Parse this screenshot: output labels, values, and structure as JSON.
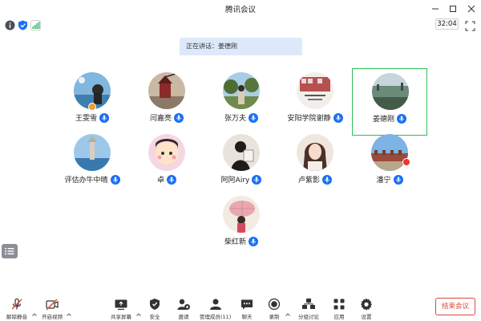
{
  "window": {
    "title": "腾讯会议"
  },
  "status": {
    "timer": "32:04"
  },
  "speaking": {
    "text": "正在讲话：姜德刚"
  },
  "participants": [
    {
      "name": "王雯雪",
      "mic": "on",
      "host": true
    },
    {
      "name": "闫嘉亮",
      "mic": "on"
    },
    {
      "name": "张万夫",
      "mic": "on"
    },
    {
      "name": "安阳学院谢静",
      "mic": "on"
    },
    {
      "name": "姜德刚",
      "mic": "on",
      "speaking": true
    },
    {
      "name": "评估办牛中晴",
      "mic": "on"
    },
    {
      "name": "卓",
      "mic": "on"
    },
    {
      "name": "阿阿Airy",
      "mic": "on"
    },
    {
      "name": "卢紫影",
      "mic": "on"
    },
    {
      "name": "潘宁",
      "mic": "on"
    },
    {
      "name": "柴红新",
      "mic": "on"
    }
  ],
  "toolbar": {
    "unmute": "解除静音",
    "video": "开启视频",
    "share": "共享屏幕",
    "security": "安全",
    "invite": "邀请",
    "members": "管理成员(11)",
    "chat": "聊天",
    "record": "录制",
    "breakout": "分组讨论",
    "apps": "应用",
    "settings": "设置",
    "end": "结束会议"
  },
  "colors": {
    "accent": "#1a6ff5",
    "highlight": "#2fbd5a",
    "danger": "#e0473c",
    "banner": "#dde9fb"
  }
}
